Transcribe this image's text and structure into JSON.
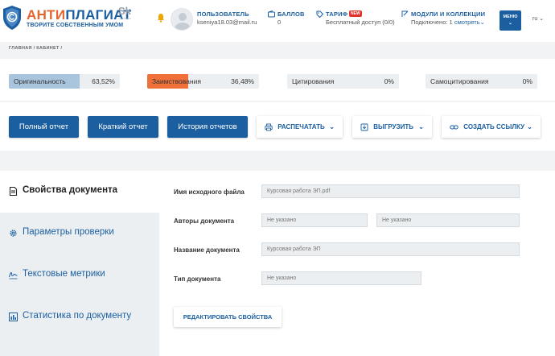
{
  "brand": {
    "name_part1": "АНТИ",
    "name_part2": "ПЛАГИАТ",
    "tagline": "ТВОРИТЕ СОБСТВЕННЫМ УМОМ",
    "partner_logo": "Sk",
    "partner_sub": "Skolkovo",
    "color_orange": "#e1672f",
    "color_blue": "#1b5fa1"
  },
  "header": {
    "user_label": "ПОЛЬЗОВАТЕЛЬ",
    "user_email": "kseniya18.03@mail.ru",
    "balance_label": "БАЛЛОВ",
    "balance_value": "0",
    "tariff_label": "ТАРИФ",
    "tariff_badge": "NEW",
    "tariff_value": "Бесплатный доступ (0/0)",
    "modules_label": "МОДУЛИ И КОЛЛЕКЦИИ",
    "modules_value": "Подключено: 1",
    "modules_link": "смотреть",
    "menu_label": "МЕНЮ",
    "lang": "ru"
  },
  "breadcrumb": {
    "home": "ГЛАВНАЯ",
    "cabinet": "КАБИНЕТ",
    "sep": "/"
  },
  "stats": [
    {
      "name": "Оригинальность",
      "pct": "63,52%",
      "fraction": 0.6352,
      "color": "#a9c4dd"
    },
    {
      "name": "Заимствования",
      "pct": "36,48%",
      "fraction": 0.3648,
      "color": "#f0703a"
    },
    {
      "name": "Цитирования",
      "pct": "0%",
      "fraction": 0,
      "color": "#a9c4dd"
    },
    {
      "name": "Самоцитирования",
      "pct": "0%",
      "fraction": 0,
      "color": "#a9c4dd"
    }
  ],
  "actions": {
    "full_report": "Полный отчет",
    "short_report": "Краткий отчет",
    "history": "История отчетов",
    "print": "РАСПЕЧАТАТЬ",
    "export": "ВЫГРУЗИТЬ",
    "link": "СОЗДАТЬ ССЫЛКУ"
  },
  "sidebar": {
    "items": [
      {
        "label": "Свойства документа",
        "icon": "document-icon"
      },
      {
        "label": "Параметры проверки",
        "icon": "gear-icon"
      },
      {
        "label": "Текстовые метрики",
        "icon": "signature-icon"
      },
      {
        "label": "Статистика по документу",
        "icon": "bar-chart-icon"
      }
    ]
  },
  "form": {
    "filename_label": "Имя исходного файла",
    "filename_value": "Курсовая работа ЭП.pdf",
    "authors_label": "Авторы документа",
    "author1_value": "Не указано",
    "author2_value": "Не указано",
    "title_label": "Название документа",
    "title_value": "Курсовая работа ЭП",
    "type_label": "Тип документа",
    "type_value": "Не указано",
    "edit_button": "РЕДАКТИРОВАТЬ СВОЙСТВА"
  }
}
